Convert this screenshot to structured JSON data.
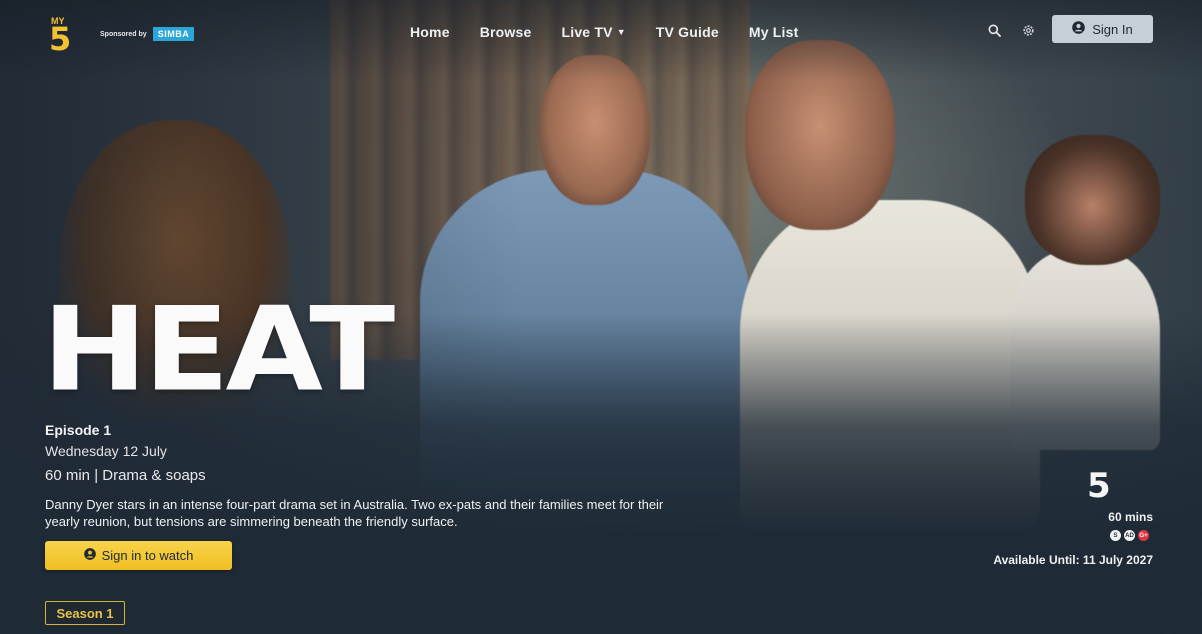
{
  "header": {
    "sponsor_text": "Sponsored by",
    "sponsor_brand": "SIMBA",
    "nav": {
      "home": "Home",
      "browse": "Browse",
      "live_tv": "Live TV",
      "tv_guide": "TV Guide",
      "my_list": "My List"
    },
    "sign_in_label": "Sign In",
    "icons": [
      "search-icon",
      "gear-icon",
      "user-circle-icon",
      "chevron-down-icon"
    ]
  },
  "hero": {
    "title": "HEAT",
    "episode": "Episode 1",
    "date": "Wednesday 12 July",
    "meta": "60 min | Drama & soaps",
    "description": "Danny Dyer stars in an intense four-part drama set in Australia. Two ex-pats and their families meet for their yearly reunion, but tensions are simmering beneath the friendly surface.",
    "watch_label": "Sign in to watch",
    "season_label": "Season 1"
  },
  "info": {
    "duration": "60 mins",
    "badges": [
      "S",
      "AD",
      "G+"
    ],
    "available": "Available Until: 11 July 2027"
  },
  "colors": {
    "accent_yellow": "#f0bf22",
    "page_bg": "#1e2a36",
    "sign_in_bg": "#c6ced6",
    "sponsor_badge": "#2aa6d9"
  }
}
